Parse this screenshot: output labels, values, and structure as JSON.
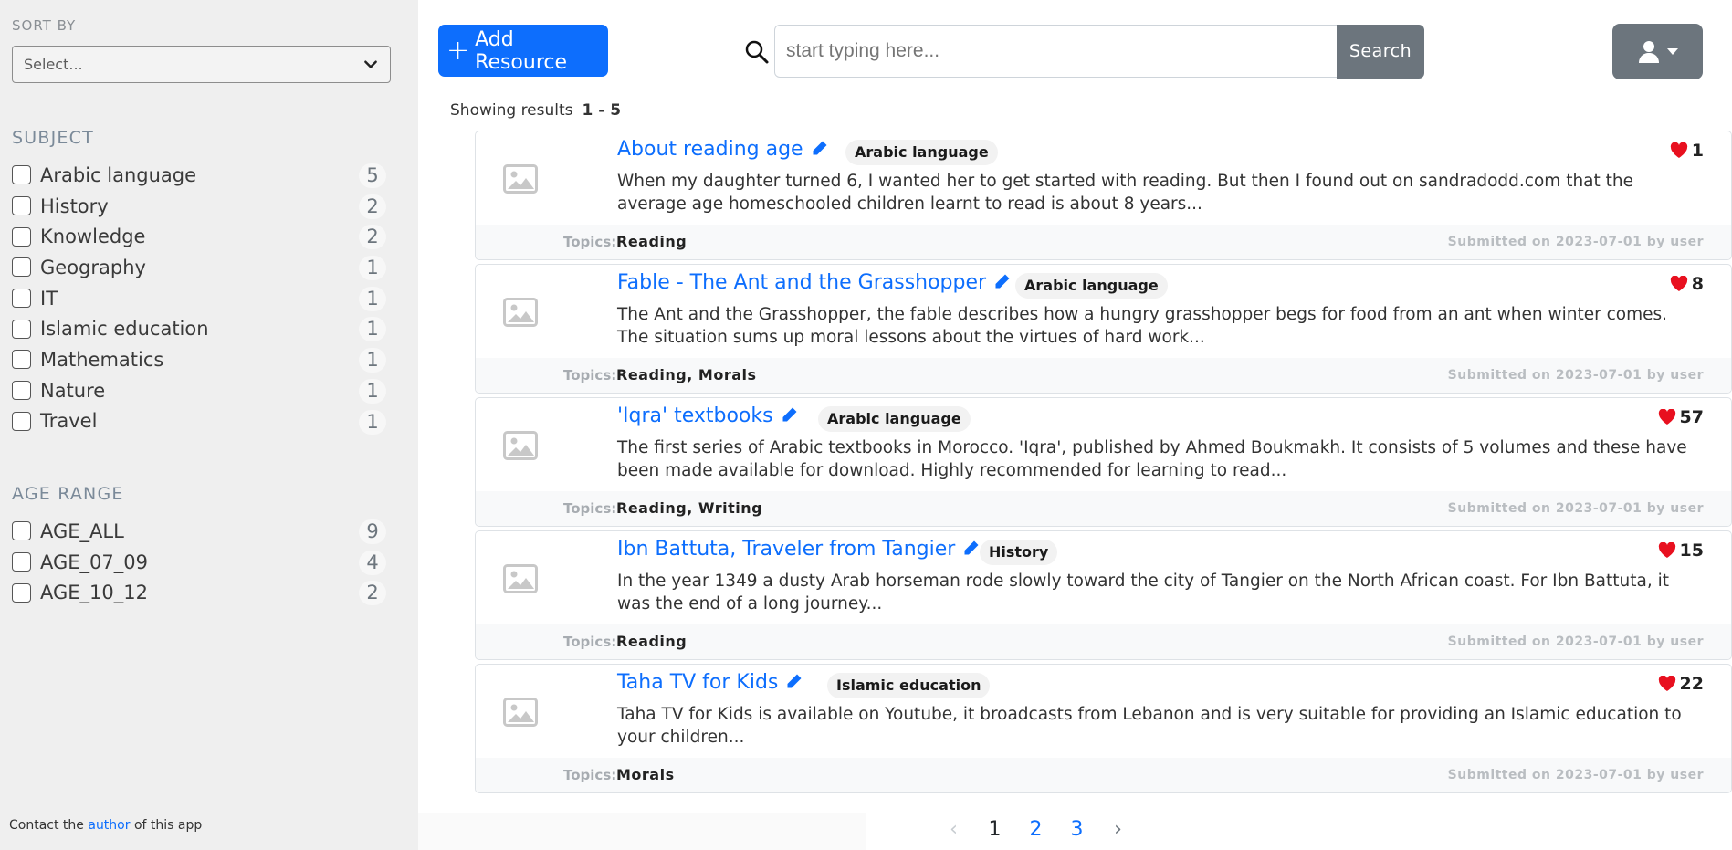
{
  "sidebar": {
    "sort_label": "SORT BY",
    "sort_value": "Select...",
    "subject_title": "SUBJECT",
    "subjects": [
      {
        "label": "Arabic language",
        "count": "5"
      },
      {
        "label": "History",
        "count": "2"
      },
      {
        "label": "Knowledge",
        "count": "2"
      },
      {
        "label": "Geography",
        "count": "1"
      },
      {
        "label": "IT",
        "count": "1"
      },
      {
        "label": "Islamic education",
        "count": "1"
      },
      {
        "label": "Mathematics",
        "count": "1"
      },
      {
        "label": "Nature",
        "count": "1"
      },
      {
        "label": "Travel",
        "count": "1"
      }
    ],
    "age_title": "AGE RANGE",
    "ages": [
      {
        "label": "AGE_ALL",
        "count": "9"
      },
      {
        "label": "AGE_07_09",
        "count": "4"
      },
      {
        "label": "AGE_10_12",
        "count": "2"
      }
    ],
    "footer_prefix": "Contact the",
    "footer_link": "author",
    "footer_suffix": "of this app"
  },
  "header": {
    "add_label": "Add Resource",
    "search_placeholder": "start typing here...",
    "search_button": "Search"
  },
  "results": {
    "showing_label": "Showing results",
    "range": "1 - 5",
    "topics_label": "Topics:",
    "items": [
      {
        "title": "About reading age",
        "subject": "Arabic language",
        "likes": "1",
        "description": "When my daughter turned 6, I wanted her to get started with reading. But then I found out on sandradodd.com that the average age homeschooled children learnt to read is about 8 years...",
        "topics": "Reading",
        "submitted": "Submitted on 2023-07-01 by user"
      },
      {
        "title": "Fable - The Ant and the Grasshopper",
        "subject": "Arabic language",
        "likes": "8",
        "description": "The Ant and the Grasshopper, the fable describes how a hungry grasshopper begs for food from an ant when winter comes. The situation sums up moral lessons about the virtues of hard work...",
        "topics": "Reading, Morals",
        "submitted": "Submitted on 2023-07-01 by user"
      },
      {
        "title": "'Iqra' textbooks",
        "subject": "Arabic language",
        "likes": "57",
        "description": "The first series of Arabic textbooks in Morocco. 'Iqra', published by Ahmed Boukmakh. It consists of 5 volumes and these have been made available for download. Highly recommended for learning to read...",
        "topics": "Reading, Writing",
        "submitted": "Submitted on 2023-07-01 by user"
      },
      {
        "title": "Ibn Battuta, Traveler from Tangier",
        "subject": "History",
        "likes": "15",
        "description": "In the year 1349 a dusty Arab horseman rode slowly toward the city of Tangier on the North African coast. For Ibn Battuta, it was the end of a long journey...",
        "topics": "Reading",
        "submitted": "Submitted on 2023-07-01 by user"
      },
      {
        "title": "Taha TV for Kids",
        "subject": "Islamic education",
        "likes": "22",
        "description": "Taha TV for Kids is available on Youtube, it broadcasts from Lebanon and is very suitable for providing an Islamic education to your children...",
        "topics": "Morals",
        "submitted": "Submitted on 2023-07-01 by user"
      }
    ]
  },
  "pagination": {
    "prev": "‹",
    "pages": [
      "1",
      "2",
      "3"
    ],
    "next": "›",
    "active": "1"
  }
}
